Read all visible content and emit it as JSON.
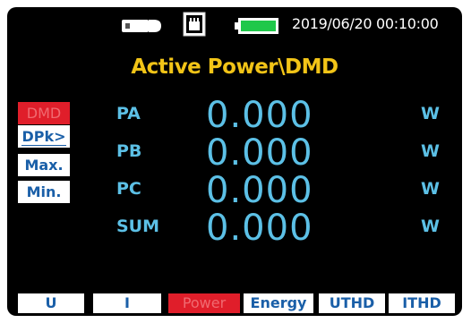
{
  "status": {
    "usb_icon": "usb-plug-icon",
    "sd_icon": "sd-card-icon",
    "battery_icon": "battery-icon",
    "battery_level": 1.0,
    "datetime": "2019/06/20 00:10:00"
  },
  "title": "Active Power\\DMD",
  "mode_buttons": [
    {
      "label": "DMD",
      "active": true
    },
    {
      "label": "DPk>",
      "active": false
    },
    {
      "label": "Max.",
      "active": false
    },
    {
      "label": "Min.",
      "active": false
    }
  ],
  "readings": [
    {
      "label": "PA",
      "value": "0.000",
      "unit": "W"
    },
    {
      "label": "PB",
      "value": "0.000",
      "unit": "W"
    },
    {
      "label": "PC",
      "value": "0.000",
      "unit": "W"
    },
    {
      "label": "SUM",
      "value": "0.000",
      "unit": "W"
    }
  ],
  "tabs": [
    {
      "label": "U",
      "active": false
    },
    {
      "label": "I",
      "active": false
    },
    {
      "label": "Power",
      "active": true
    },
    {
      "label": "Energy",
      "active": false
    },
    {
      "label": "UTHD",
      "active": false
    },
    {
      "label": "ITHD",
      "active": false
    }
  ],
  "colors": {
    "background": "#000000",
    "title": "#f2c417",
    "reading": "#5cc0e6",
    "active_tab": "#e01e2a",
    "tab_text": "#1a5fa8",
    "battery": "#1fc84a"
  }
}
